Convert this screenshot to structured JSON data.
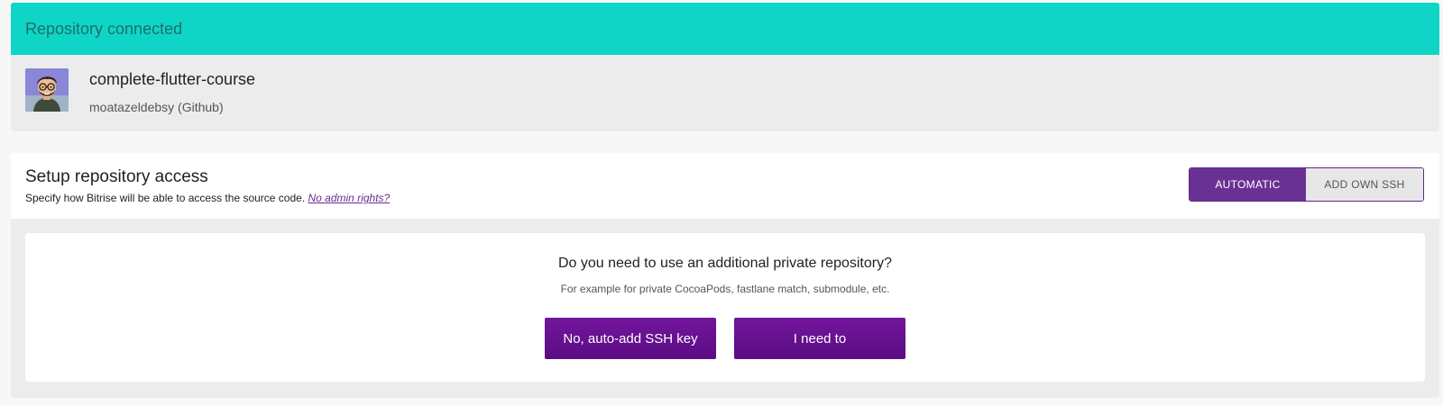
{
  "repo": {
    "banner": "Repository connected",
    "name": "complete-flutter-course",
    "owner": "moatazeldebsy (Github)"
  },
  "access": {
    "title": "Setup repository access",
    "subtitle": "Specify how Bitrise will be able to access the source code.",
    "no_admin_link": "No admin rights?",
    "toggle": {
      "automatic": "AUTOMATIC",
      "add_own_ssh": "ADD OWN SSH",
      "selected": "AUTOMATIC"
    }
  },
  "question": {
    "text": "Do you need to use an additional private repository?",
    "note": "For example for private CocoaPods, fastlane match, submodule, etc.",
    "no_button": "No, auto-add SSH key",
    "yes_button": "I need to"
  },
  "colors": {
    "banner": "#0fd5c6",
    "accent": "#6a3194",
    "button": "#5a0c83"
  }
}
